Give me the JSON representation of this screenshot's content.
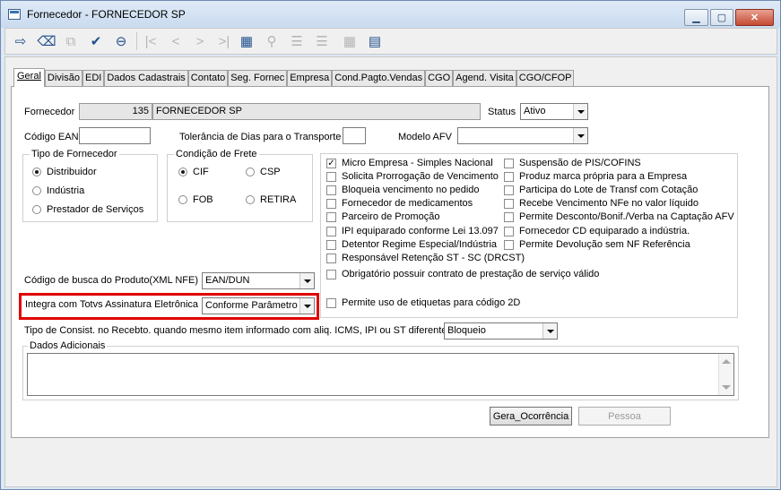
{
  "window": {
    "title": "Fornecedor - FORNECEDOR SP"
  },
  "tabs": [
    "Geral",
    "Divisão",
    "EDI",
    "Dados Cadastrais",
    "Contato",
    "Seg. Fornec",
    "Empresa",
    "Cond.Pagto.Vendas",
    "CGO",
    "Agend. Visita",
    "CGO/CFOP"
  ],
  "form": {
    "fornecedor_label": "Fornecedor",
    "fornecedor_code": "135",
    "fornecedor_name": "FORNECEDOR SP",
    "status_label": "Status",
    "status_value": "Ativo",
    "ean_label": "Código EAN",
    "ean_value": "",
    "tolerancia_label": "Tolerância de Dias para o Transporte",
    "tolerancia_value": "",
    "afv_label": "Modelo AFV",
    "afv_value": ""
  },
  "tipo_fornecedor": {
    "caption": "Tipo de Fornecedor",
    "options": [
      "Distribuidor",
      "Indústria",
      "Prestador de Serviços"
    ],
    "selected": "Distribuidor"
  },
  "condicao_frete": {
    "caption": "Condição de Frete",
    "options": [
      "CIF",
      "CSP",
      "FOB",
      "RETIRA"
    ],
    "selected": "CIF"
  },
  "checkboxes_left": [
    {
      "label": "Micro Empresa - Simples Nacional",
      "checked": true
    },
    {
      "label": "Solicita Prorrogação de Vencimento",
      "checked": false
    },
    {
      "label": "Bloqueia vencimento no pedido",
      "checked": false
    },
    {
      "label": "Fornecedor de medicamentos",
      "checked": false
    },
    {
      "label": "Parceiro de Promoção",
      "checked": false
    },
    {
      "label": "IPI equiparado conforme Lei 13.097",
      "checked": false
    },
    {
      "label": "Detentor Regime Especial/Indústria",
      "checked": false
    },
    {
      "label": "Responsável Retenção ST - SC (DRCST)",
      "checked": false
    },
    {
      "label": "Obrigatório possuir contrato de prestação de serviço válido",
      "checked": false
    }
  ],
  "checkboxes_right": [
    {
      "label": "Suspensão de PIS/COFINS",
      "checked": false
    },
    {
      "label": "Produz marca própria para a Empresa",
      "checked": false
    },
    {
      "label": "Participa do Lote de Transf com Cotação",
      "checked": false
    },
    {
      "label": "Recebe Vencimento NFe no valor líquido",
      "checked": false
    },
    {
      "label": "Permite Desconto/Bonif./Verba na Captação AFV",
      "checked": false
    },
    {
      "label": "Fornecedor CD equiparado a indústria.",
      "checked": false
    },
    {
      "label": "Permite Devolução sem NF Referência",
      "checked": false
    }
  ],
  "codigo_busca": {
    "label": "Código de busca do Produto(XML NFE) :",
    "value": "EAN/DUN"
  },
  "totvs": {
    "label": "Integra com Totvs Assinatura Eletrônica",
    "value": "Conforme Parâmetro"
  },
  "etiquetas": {
    "label": "Permite uso de etiquetas para código 2D",
    "checked": false
  },
  "consist": {
    "label": "Tipo de Consist. no Recebto. quando mesmo item informado com aliq. ICMS, IPI ou ST diferentes:",
    "value": "Bloqueio"
  },
  "dados_adicionais": {
    "caption": "Dados Adicionais",
    "value": ""
  },
  "buttons": {
    "gera_ocorrencia": "Gera_Ocorrência",
    "pessoa": "Pessoa"
  }
}
